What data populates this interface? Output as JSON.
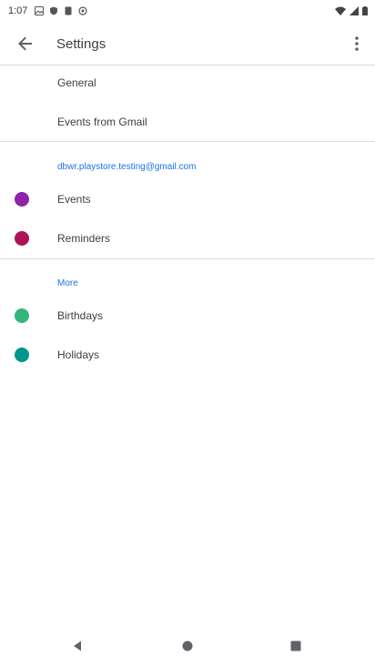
{
  "status": {
    "time": "1:07"
  },
  "app_bar": {
    "title": "Settings"
  },
  "settings": {
    "general": "General",
    "events_from_gmail": "Events from Gmail"
  },
  "account": {
    "email": "dbwr.playstore.testing@gmail.com",
    "items": [
      {
        "label": "Events",
        "color": "#8e24aa"
      },
      {
        "label": "Reminders",
        "color": "#ad1457"
      }
    ]
  },
  "more": {
    "header": "More",
    "items": [
      {
        "label": "Birthdays",
        "color": "#33b679"
      },
      {
        "label": "Holidays",
        "color": "#009688"
      }
    ]
  },
  "icons": {
    "back": "back-arrow-icon",
    "overflow": "more-vert-icon",
    "nav_back": "nav-back-icon",
    "nav_home": "nav-home-icon",
    "nav_recents": "nav-recents-icon"
  }
}
